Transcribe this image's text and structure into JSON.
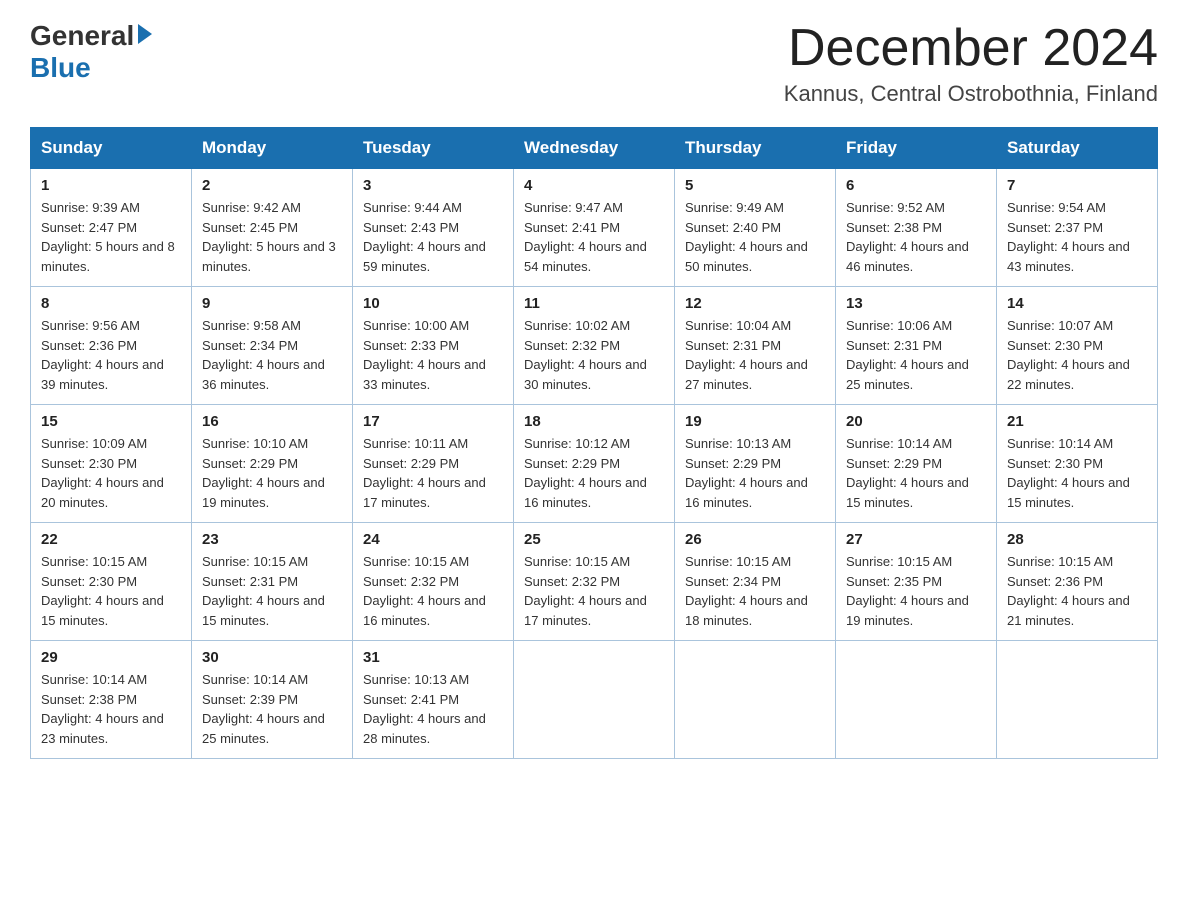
{
  "header": {
    "logo_general": "General",
    "logo_blue": "Blue",
    "month_title": "December 2024",
    "subtitle": "Kannus, Central Ostrobothnia, Finland"
  },
  "days_of_week": [
    "Sunday",
    "Monday",
    "Tuesday",
    "Wednesday",
    "Thursday",
    "Friday",
    "Saturday"
  ],
  "weeks": [
    [
      {
        "day": "1",
        "sunrise": "Sunrise: 9:39 AM",
        "sunset": "Sunset: 2:47 PM",
        "daylight": "Daylight: 5 hours and 8 minutes."
      },
      {
        "day": "2",
        "sunrise": "Sunrise: 9:42 AM",
        "sunset": "Sunset: 2:45 PM",
        "daylight": "Daylight: 5 hours and 3 minutes."
      },
      {
        "day": "3",
        "sunrise": "Sunrise: 9:44 AM",
        "sunset": "Sunset: 2:43 PM",
        "daylight": "Daylight: 4 hours and 59 minutes."
      },
      {
        "day": "4",
        "sunrise": "Sunrise: 9:47 AM",
        "sunset": "Sunset: 2:41 PM",
        "daylight": "Daylight: 4 hours and 54 minutes."
      },
      {
        "day": "5",
        "sunrise": "Sunrise: 9:49 AM",
        "sunset": "Sunset: 2:40 PM",
        "daylight": "Daylight: 4 hours and 50 minutes."
      },
      {
        "day": "6",
        "sunrise": "Sunrise: 9:52 AM",
        "sunset": "Sunset: 2:38 PM",
        "daylight": "Daylight: 4 hours and 46 minutes."
      },
      {
        "day": "7",
        "sunrise": "Sunrise: 9:54 AM",
        "sunset": "Sunset: 2:37 PM",
        "daylight": "Daylight: 4 hours and 43 minutes."
      }
    ],
    [
      {
        "day": "8",
        "sunrise": "Sunrise: 9:56 AM",
        "sunset": "Sunset: 2:36 PM",
        "daylight": "Daylight: 4 hours and 39 minutes."
      },
      {
        "day": "9",
        "sunrise": "Sunrise: 9:58 AM",
        "sunset": "Sunset: 2:34 PM",
        "daylight": "Daylight: 4 hours and 36 minutes."
      },
      {
        "day": "10",
        "sunrise": "Sunrise: 10:00 AM",
        "sunset": "Sunset: 2:33 PM",
        "daylight": "Daylight: 4 hours and 33 minutes."
      },
      {
        "day": "11",
        "sunrise": "Sunrise: 10:02 AM",
        "sunset": "Sunset: 2:32 PM",
        "daylight": "Daylight: 4 hours and 30 minutes."
      },
      {
        "day": "12",
        "sunrise": "Sunrise: 10:04 AM",
        "sunset": "Sunset: 2:31 PM",
        "daylight": "Daylight: 4 hours and 27 minutes."
      },
      {
        "day": "13",
        "sunrise": "Sunrise: 10:06 AM",
        "sunset": "Sunset: 2:31 PM",
        "daylight": "Daylight: 4 hours and 25 minutes."
      },
      {
        "day": "14",
        "sunrise": "Sunrise: 10:07 AM",
        "sunset": "Sunset: 2:30 PM",
        "daylight": "Daylight: 4 hours and 22 minutes."
      }
    ],
    [
      {
        "day": "15",
        "sunrise": "Sunrise: 10:09 AM",
        "sunset": "Sunset: 2:30 PM",
        "daylight": "Daylight: 4 hours and 20 minutes."
      },
      {
        "day": "16",
        "sunrise": "Sunrise: 10:10 AM",
        "sunset": "Sunset: 2:29 PM",
        "daylight": "Daylight: 4 hours and 19 minutes."
      },
      {
        "day": "17",
        "sunrise": "Sunrise: 10:11 AM",
        "sunset": "Sunset: 2:29 PM",
        "daylight": "Daylight: 4 hours and 17 minutes."
      },
      {
        "day": "18",
        "sunrise": "Sunrise: 10:12 AM",
        "sunset": "Sunset: 2:29 PM",
        "daylight": "Daylight: 4 hours and 16 minutes."
      },
      {
        "day": "19",
        "sunrise": "Sunrise: 10:13 AM",
        "sunset": "Sunset: 2:29 PM",
        "daylight": "Daylight: 4 hours and 16 minutes."
      },
      {
        "day": "20",
        "sunrise": "Sunrise: 10:14 AM",
        "sunset": "Sunset: 2:29 PM",
        "daylight": "Daylight: 4 hours and 15 minutes."
      },
      {
        "day": "21",
        "sunrise": "Sunrise: 10:14 AM",
        "sunset": "Sunset: 2:30 PM",
        "daylight": "Daylight: 4 hours and 15 minutes."
      }
    ],
    [
      {
        "day": "22",
        "sunrise": "Sunrise: 10:15 AM",
        "sunset": "Sunset: 2:30 PM",
        "daylight": "Daylight: 4 hours and 15 minutes."
      },
      {
        "day": "23",
        "sunrise": "Sunrise: 10:15 AM",
        "sunset": "Sunset: 2:31 PM",
        "daylight": "Daylight: 4 hours and 15 minutes."
      },
      {
        "day": "24",
        "sunrise": "Sunrise: 10:15 AM",
        "sunset": "Sunset: 2:32 PM",
        "daylight": "Daylight: 4 hours and 16 minutes."
      },
      {
        "day": "25",
        "sunrise": "Sunrise: 10:15 AM",
        "sunset": "Sunset: 2:32 PM",
        "daylight": "Daylight: 4 hours and 17 minutes."
      },
      {
        "day": "26",
        "sunrise": "Sunrise: 10:15 AM",
        "sunset": "Sunset: 2:34 PM",
        "daylight": "Daylight: 4 hours and 18 minutes."
      },
      {
        "day": "27",
        "sunrise": "Sunrise: 10:15 AM",
        "sunset": "Sunset: 2:35 PM",
        "daylight": "Daylight: 4 hours and 19 minutes."
      },
      {
        "day": "28",
        "sunrise": "Sunrise: 10:15 AM",
        "sunset": "Sunset: 2:36 PM",
        "daylight": "Daylight: 4 hours and 21 minutes."
      }
    ],
    [
      {
        "day": "29",
        "sunrise": "Sunrise: 10:14 AM",
        "sunset": "Sunset: 2:38 PM",
        "daylight": "Daylight: 4 hours and 23 minutes."
      },
      {
        "day": "30",
        "sunrise": "Sunrise: 10:14 AM",
        "sunset": "Sunset: 2:39 PM",
        "daylight": "Daylight: 4 hours and 25 minutes."
      },
      {
        "day": "31",
        "sunrise": "Sunrise: 10:13 AM",
        "sunset": "Sunset: 2:41 PM",
        "daylight": "Daylight: 4 hours and 28 minutes."
      },
      null,
      null,
      null,
      null
    ]
  ]
}
